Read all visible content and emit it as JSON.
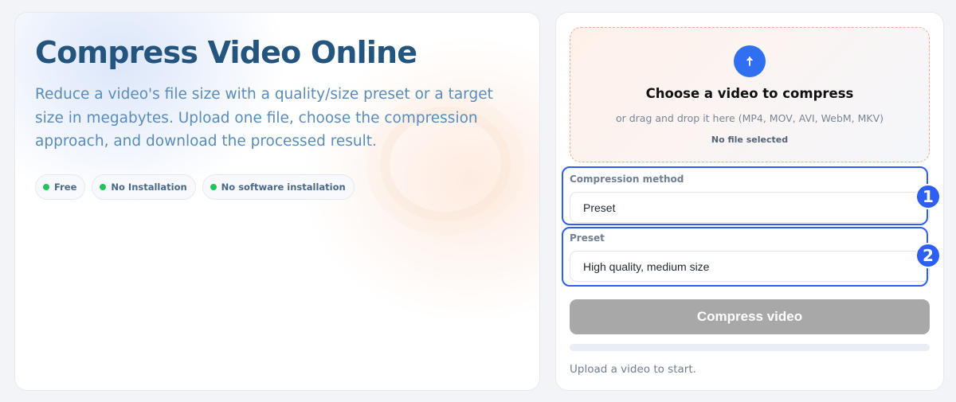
{
  "hero": {
    "title": "Compress Video Online",
    "subtitle": "Reduce a video's file size with a quality/size preset or a target size in megabytes. Upload one file, choose the compression approach, and download the processed result.",
    "badges": [
      "Free",
      "No Installation",
      "No software installation"
    ]
  },
  "upload": {
    "title": "Choose a video to compress",
    "hint": "or drag and drop it here (MP4, MOV, AVI, WebM, MKV)",
    "status": "No file selected",
    "icon": "arrow-up-icon"
  },
  "compression_method": {
    "label": "Compression method",
    "value": "Preset"
  },
  "preset": {
    "label": "Preset",
    "value": "High quality, medium size"
  },
  "actions": {
    "compress_label": "Compress video"
  },
  "progress": {
    "value": 0
  },
  "status_text": "Upload a video to start.",
  "annotations": [
    "1",
    "2"
  ],
  "colors": {
    "accent": "#2f6ff0",
    "title": "#24557e",
    "subtitle": "#5a8cba",
    "badge_dot": "#22c35b",
    "button_disabled": "#a8a8a8",
    "highlight": "#2c5ff2",
    "dropzone_border": "#f2a98b"
  }
}
